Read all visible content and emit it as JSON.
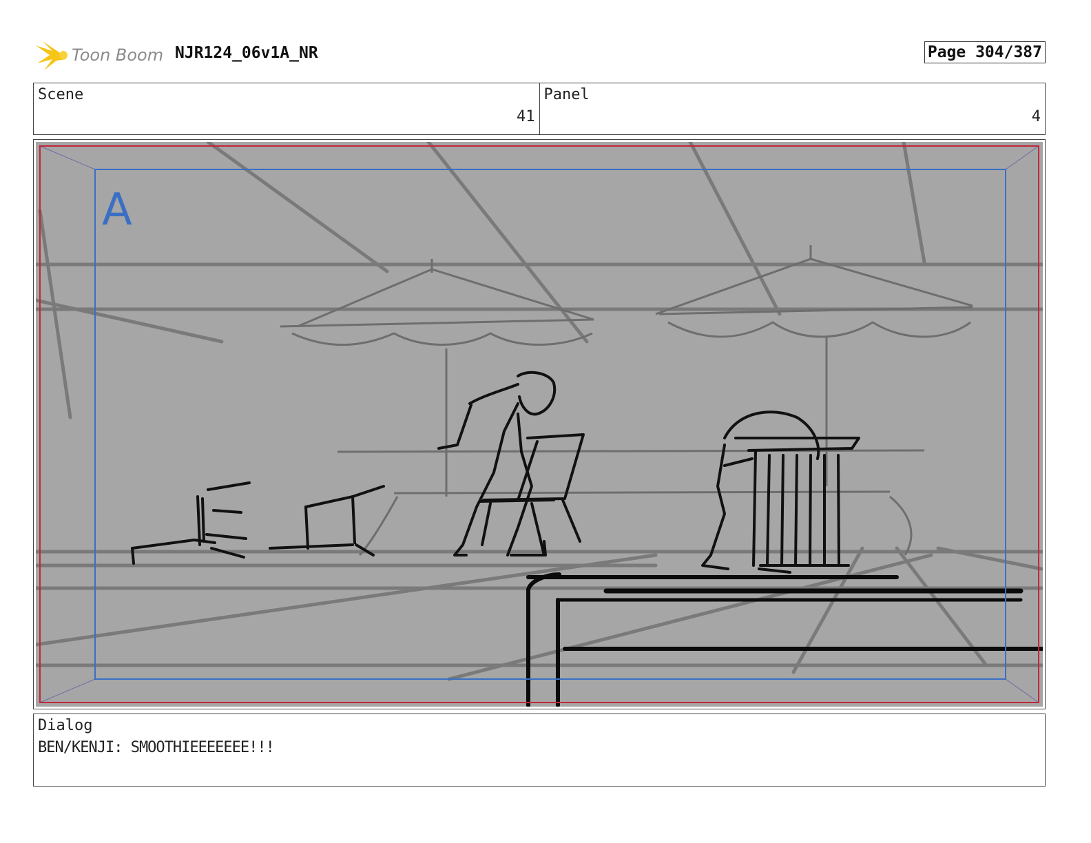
{
  "header": {
    "logo_text": "Toon Boom",
    "project_name": "NJR124_06v1A_NR",
    "page_label": "Page 304/387"
  },
  "scene": {
    "label": "Scene",
    "value": "41"
  },
  "panel": {
    "label": "Panel",
    "value": "4",
    "frame_letter": "A"
  },
  "dialog": {
    "label": "Dialog",
    "text": "BEN/KENJI: SMOOTHIEEEEEEE!!!"
  },
  "colors": {
    "frame_red": "#c0283a",
    "frame_blue": "#3a6fc4",
    "sketch_bg": "#a6a6a6",
    "logo_yellow": "#f5c518"
  }
}
